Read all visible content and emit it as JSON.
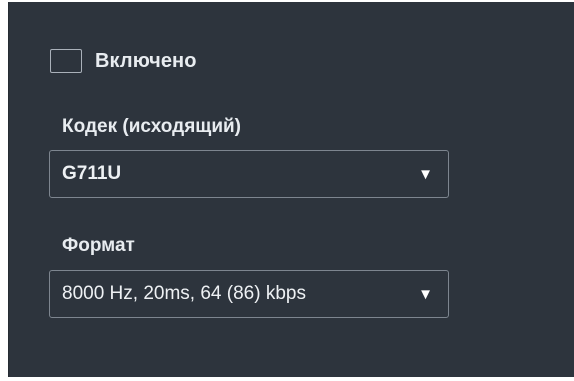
{
  "enabled": {
    "label": "Включено",
    "checked": false
  },
  "codec": {
    "label": "Кодек (исходящий)",
    "value": "G711U",
    "arrow_icon": "triangle-down-icon"
  },
  "format": {
    "label": "Формат",
    "value": "8000 Hz, 20ms, 64 (86) kbps",
    "arrow_icon": "triangle-down-icon"
  }
}
